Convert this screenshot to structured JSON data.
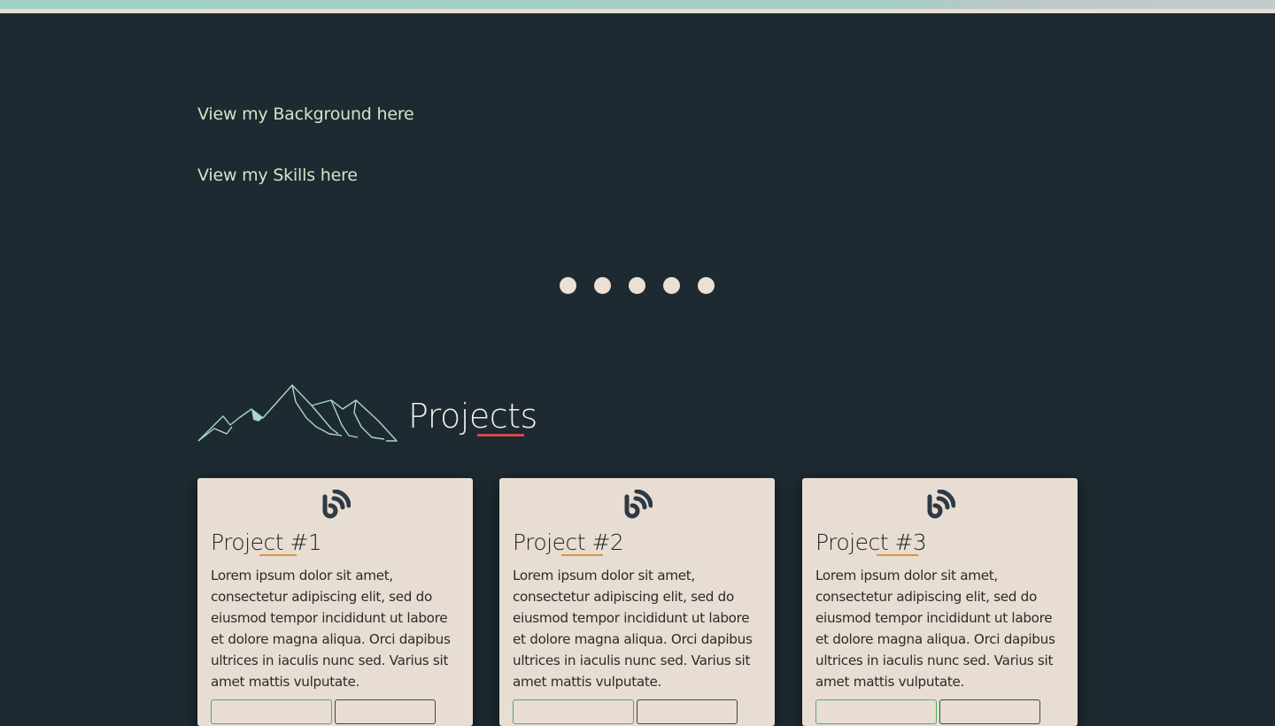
{
  "links": {
    "background": "View my Background here",
    "skills": "View my Skills here"
  },
  "carousel": {
    "dot_count": 5
  },
  "projects": {
    "title": "Projects",
    "cards": [
      {
        "title": "Project #1",
        "icon": "feed-icon",
        "description": "Lorem ipsum dolor sit amet, consectetur adipiscing elit, sed do eiusmod tempor incididunt ut labore et dolore magna aliqua. Orci dapibus ultrices in iaculis nunc sed. Varius sit amet mattis vulputate."
      },
      {
        "title": "Project #2",
        "icon": "feed-icon",
        "description": "Lorem ipsum dolor sit amet, consectetur adipiscing elit, sed do eiusmod tempor incididunt ut labore et dolore magna aliqua. Orci dapibus ultrices in iaculis nunc sed. Varius sit amet mattis vulputate."
      },
      {
        "title": "Project #3",
        "icon": "feed-icon",
        "description": "Lorem ipsum dolor sit amet, consectetur adipiscing elit, sed do eiusmod tempor incididunt ut labore et dolore magna aliqua. Orci dapibus ultrices in iaculis nunc sed. Varius sit amet mattis vulputate."
      }
    ]
  },
  "colors": {
    "background": "#1d2a31",
    "link": "#cfe6c4",
    "card": "#e8ddd2",
    "accent_red": "#d24a4a",
    "accent_orange": "#d9953d",
    "button_green": "#4caf60"
  }
}
